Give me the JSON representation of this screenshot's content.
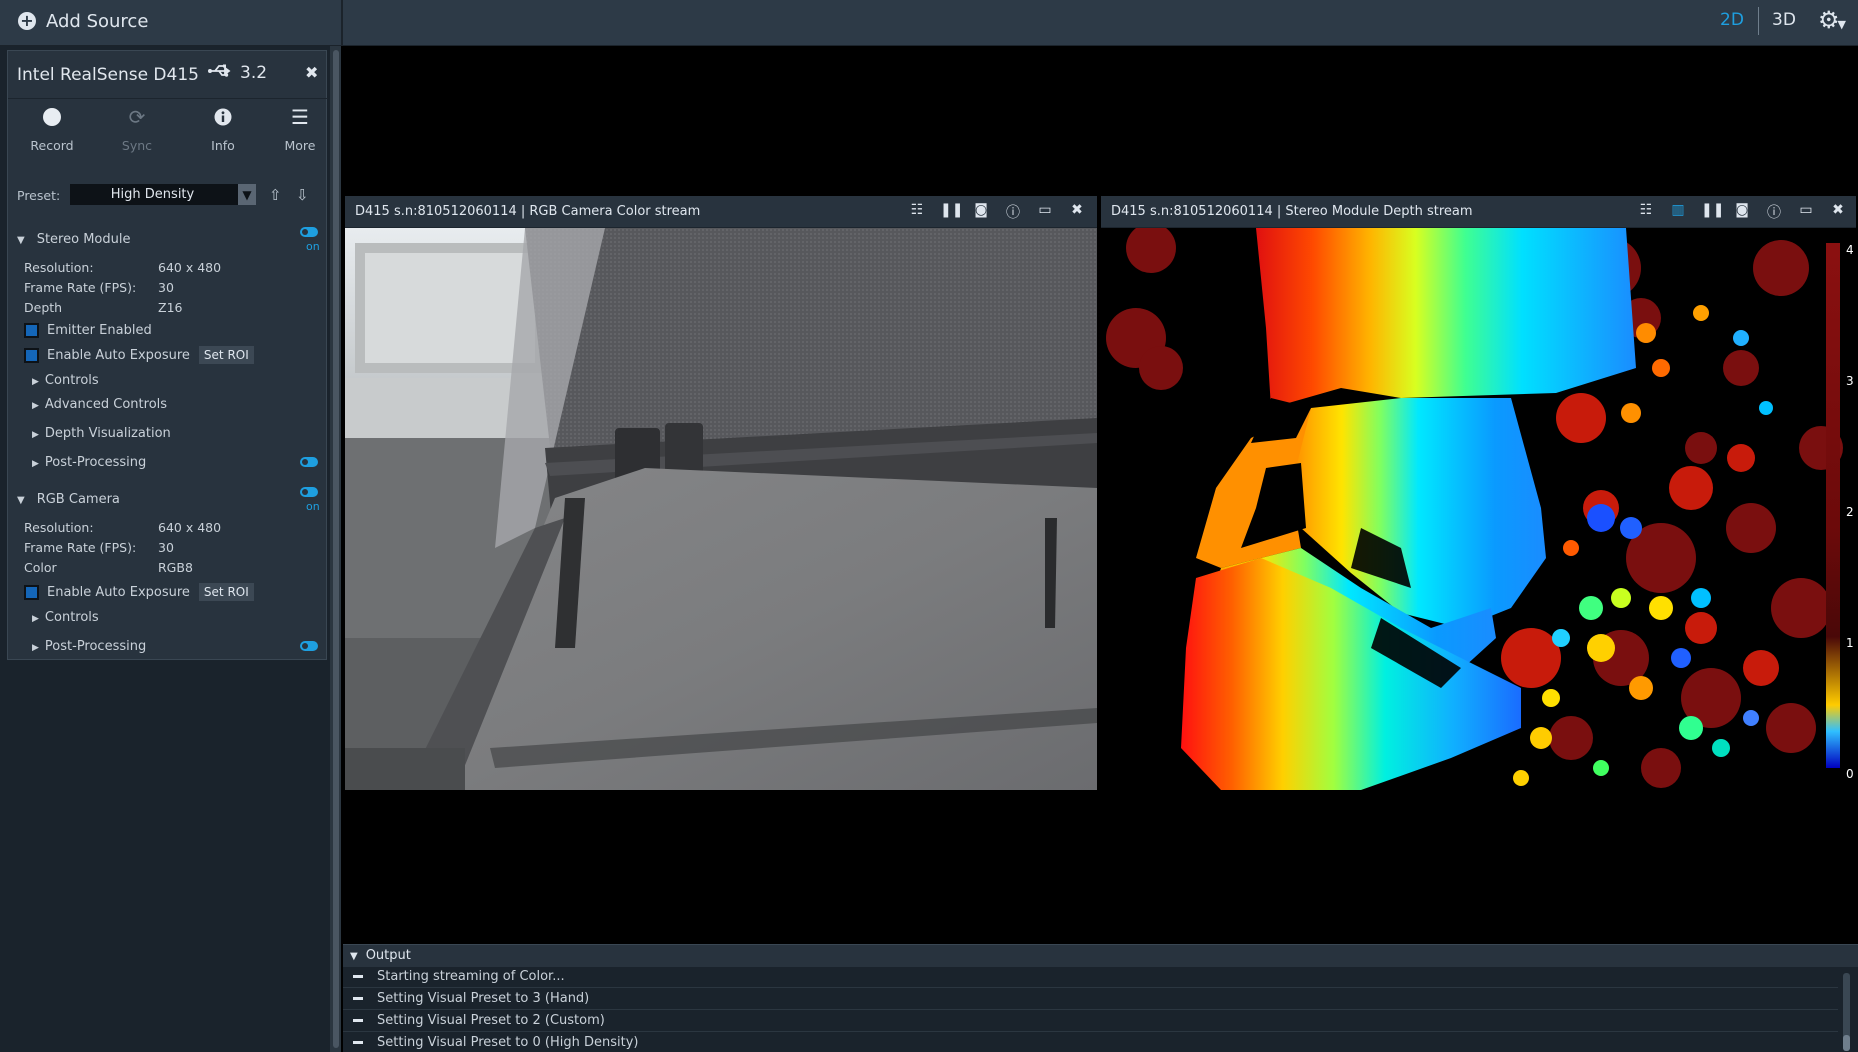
{
  "topbar": {
    "add_source_label": "Add Source",
    "view_2d": "2D",
    "view_3d": "3D",
    "accent_color": "#1e9fe0"
  },
  "device": {
    "name": "Intel RealSense D415",
    "usb_version": "3.2",
    "toolbar": {
      "record": "Record",
      "sync": "Sync",
      "info": "Info",
      "more": "More"
    },
    "preset": {
      "label": "Preset:",
      "value": "High Density"
    },
    "stereo_module": {
      "title": "Stereo Module",
      "toggle_label": "on",
      "resolution_label": "Resolution:",
      "resolution_value": "640 x 480",
      "fps_label": "Frame Rate (FPS):",
      "fps_value": "30",
      "format_label": "Depth",
      "format_value": "Z16",
      "emitter_label": "Emitter Enabled",
      "auto_exposure_label": "Enable Auto Exposure",
      "set_roi_label": "Set ROI",
      "controls": "Controls",
      "advanced_controls": "Advanced Controls",
      "depth_visualization": "Depth Visualization",
      "post_processing": "Post-Processing"
    },
    "rgb_camera": {
      "title": "RGB Camera",
      "toggle_label": "on",
      "resolution_label": "Resolution:",
      "resolution_value": "640 x 480",
      "fps_label": "Frame Rate (FPS):",
      "fps_value": "30",
      "format_label": "Color",
      "format_value": "RGB8",
      "auto_exposure_label": "Enable Auto Exposure",
      "set_roi_label": "Set ROI",
      "controls": "Controls",
      "post_processing": "Post-Processing"
    }
  },
  "streams": {
    "color": {
      "title": "D415 s.n:810512060114 | RGB Camera Color stream"
    },
    "depth": {
      "title": "D415 s.n:810512060114 | Stereo Module Depth stream",
      "scale_labels": [
        "4",
        "3",
        "2",
        "1",
        "0"
      ]
    }
  },
  "output": {
    "title": "Output",
    "lines": [
      "Starting streaming of Color...",
      "Setting Visual Preset to 3 (Hand)",
      "Setting Visual Preset to 2 (Custom)",
      "Setting Visual Preset to 0 (High Density)"
    ]
  },
  "icons": {
    "add_source": "plus-circle-icon",
    "usb": "usb-icon",
    "close": "close-icon",
    "record": "record-dot-icon",
    "sync": "sync-icon",
    "info": "info-icon",
    "more": "hamburger-menu-icon",
    "settings": "gear-icon"
  }
}
